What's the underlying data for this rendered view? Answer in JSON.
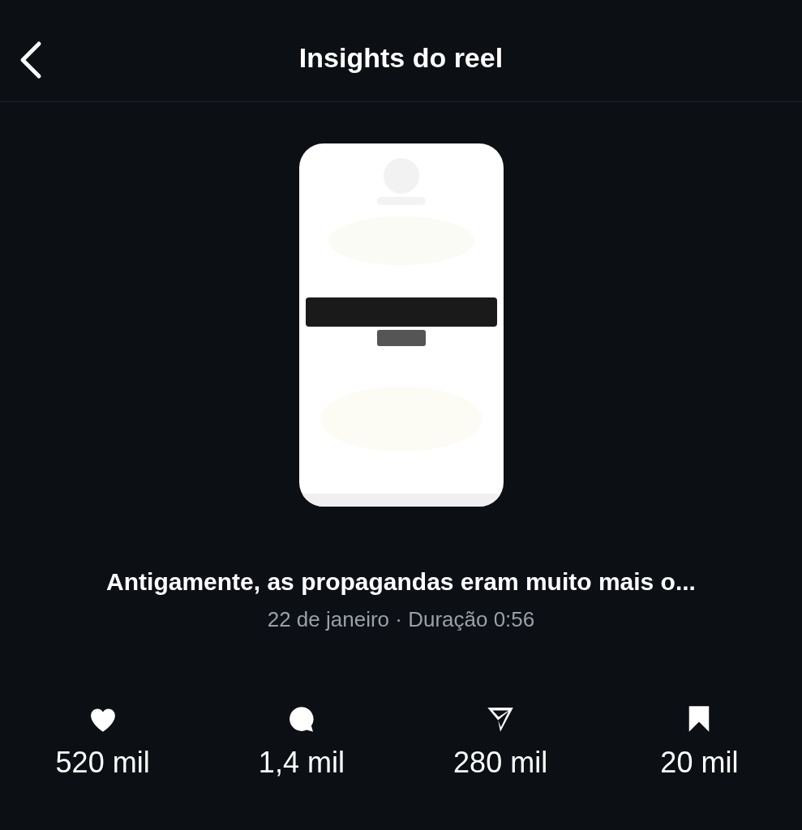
{
  "header": {
    "title": "Insights do reel"
  },
  "caption": "Antigamente, as propagandas eram muito mais o...",
  "meta": "22 de janeiro · Duração 0:56",
  "stats": [
    {
      "kind": "heart",
      "value": "520 mil"
    },
    {
      "kind": "comment",
      "value": "1,4 mil"
    },
    {
      "kind": "share",
      "value": "280 mil"
    },
    {
      "kind": "save",
      "value": "20 mil"
    }
  ]
}
